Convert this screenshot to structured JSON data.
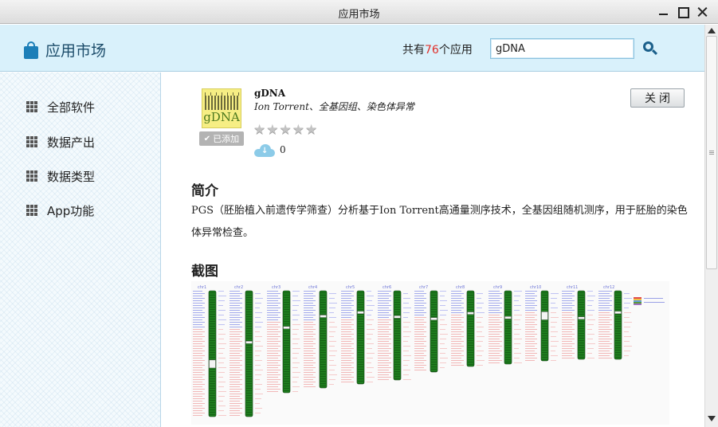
{
  "window": {
    "title": "应用市场"
  },
  "header": {
    "brand_title": "应用市场",
    "count_prefix": "共有",
    "count_value": "76",
    "count_suffix": "个应用",
    "search_value": "gDNA",
    "brand_color": "#1c7fb8",
    "count_color": "#e0312b"
  },
  "sidebar": {
    "items": [
      {
        "label": "全部软件"
      },
      {
        "label": "数据产出"
      },
      {
        "label": "数据类型"
      },
      {
        "label": "App功能"
      }
    ]
  },
  "app": {
    "icon_text": "gDNA",
    "added_label": "已添加",
    "name": "gDNA",
    "description": "Ion Torrent、全基因组、染色体异常",
    "rating": 0,
    "rating_max": 5,
    "downloads": "0",
    "close_label": "关闭"
  },
  "sections": {
    "intro_title": "简介",
    "intro_text": "PGS（胚胎植入前遗传学筛查）分析基于Ion Torrent高通量测序技术，全基因组随机测序，用于胚胎的染色体异常检查。",
    "screenshot_title": "截图"
  },
  "icons": {
    "brand": "shopping-bag-icon",
    "search": "search-icon",
    "nav": "grid-icon",
    "download": "cloud-download-icon",
    "star": "star-icon"
  }
}
